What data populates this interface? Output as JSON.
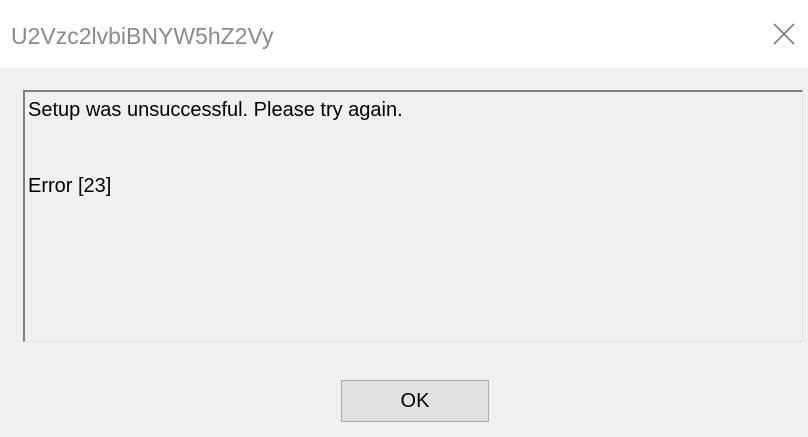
{
  "window": {
    "title": "U2Vzc2lvbiBNYW5hZ2Vy",
    "close_icon": "close-icon"
  },
  "message": {
    "line1": "Setup was unsuccessful. Please try again.",
    "line2": "Error [23]"
  },
  "buttons": {
    "ok_label": "OK"
  },
  "colors": {
    "titlebar_bg": "#ffffff",
    "dialog_bg": "#f0f0f0",
    "title_text": "#8a8a8a",
    "button_bg": "#e1e1e1",
    "button_border": "#adadad"
  }
}
